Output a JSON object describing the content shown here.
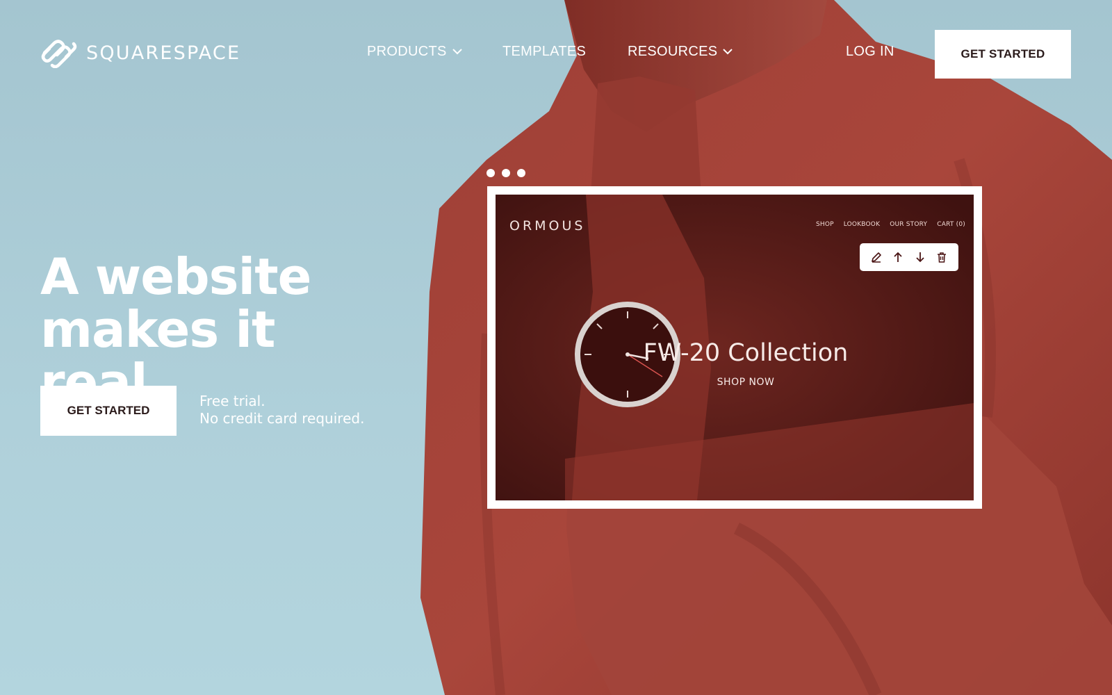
{
  "brand": {
    "name": "SQUARESPACE"
  },
  "nav": {
    "items": [
      {
        "label": "PRODUCTS",
        "dropdown": true
      },
      {
        "label": "TEMPLATES",
        "dropdown": false
      },
      {
        "label": "RESOURCES",
        "dropdown": true
      }
    ],
    "login": "LOG IN",
    "cta": "GET STARTED"
  },
  "hero": {
    "title_line1": "A website",
    "title_line2": "makes it real.",
    "cta": "GET STARTED",
    "note_line1": "Free trial.",
    "note_line2": "No credit card required."
  },
  "mockup": {
    "brand": "ORMOUS",
    "nav": [
      "SHOP",
      "LOOKBOOK",
      "OUR STORY",
      "CART (0)"
    ],
    "toolbar": [
      "pencil-icon",
      "arrow-up-icon",
      "arrow-down-icon",
      "trash-icon"
    ],
    "headline": "FW-20 Collection",
    "cta": "SHOP NOW"
  },
  "colors": {
    "background": "#a9c8d3",
    "sweater": "#a8443a",
    "text_dark": "#2a1a1a"
  }
}
